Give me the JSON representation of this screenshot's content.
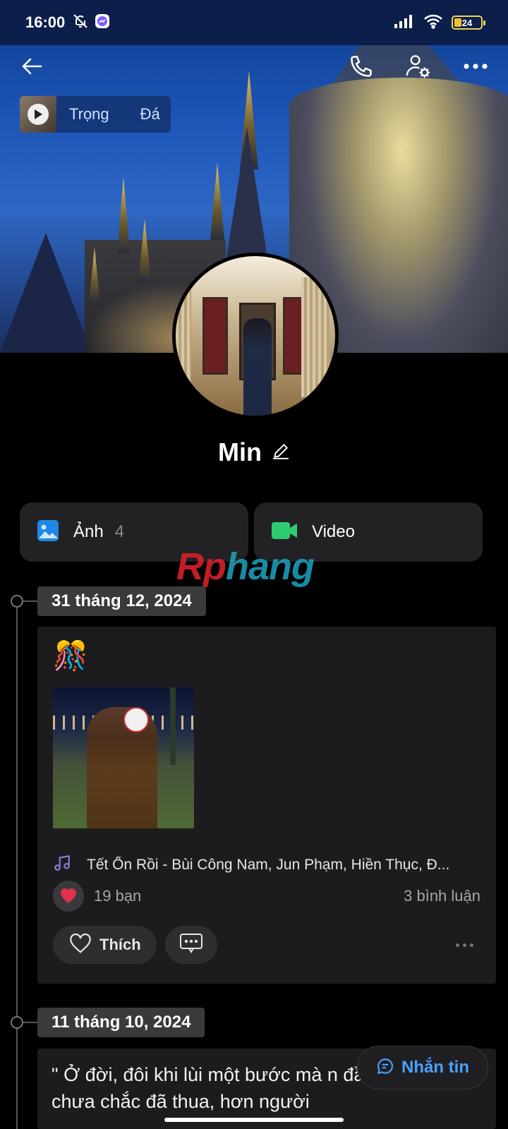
{
  "status_bar": {
    "time": "16:00",
    "battery": "24"
  },
  "music_chip": {
    "text": "Trọng",
    "text_tail": "Đá"
  },
  "profile": {
    "name": "Min"
  },
  "media": {
    "photos_label": "Ảnh",
    "photos_count": "4",
    "video_label": "Video"
  },
  "watermark": {
    "part1": "Rp",
    "part2": "hang"
  },
  "posts": [
    {
      "date": "31 tháng 12, 2024",
      "emoji": "🎊",
      "song": "Tết Ổn Rồi - Bùi Công Nam, Jun Phạm, Hiền Thục, Đ...",
      "reactions": "19 bạn",
      "comments": "3 bình luận",
      "like_label": "Thích"
    },
    {
      "date": "11 tháng 10, 2024",
      "text": "\" Ở đời, đôi khi lùi một bước mà n đầu một lần chưa chắc đã thua, hơn người"
    }
  ],
  "message_button": {
    "label": "Nhắn tin"
  },
  "colors": {
    "accent": "#4aa0ff",
    "photo_icon": "#1e88e5",
    "video_icon": "#2ecc71",
    "music_note": "#8e7ad8",
    "heart": "#e0304a"
  }
}
